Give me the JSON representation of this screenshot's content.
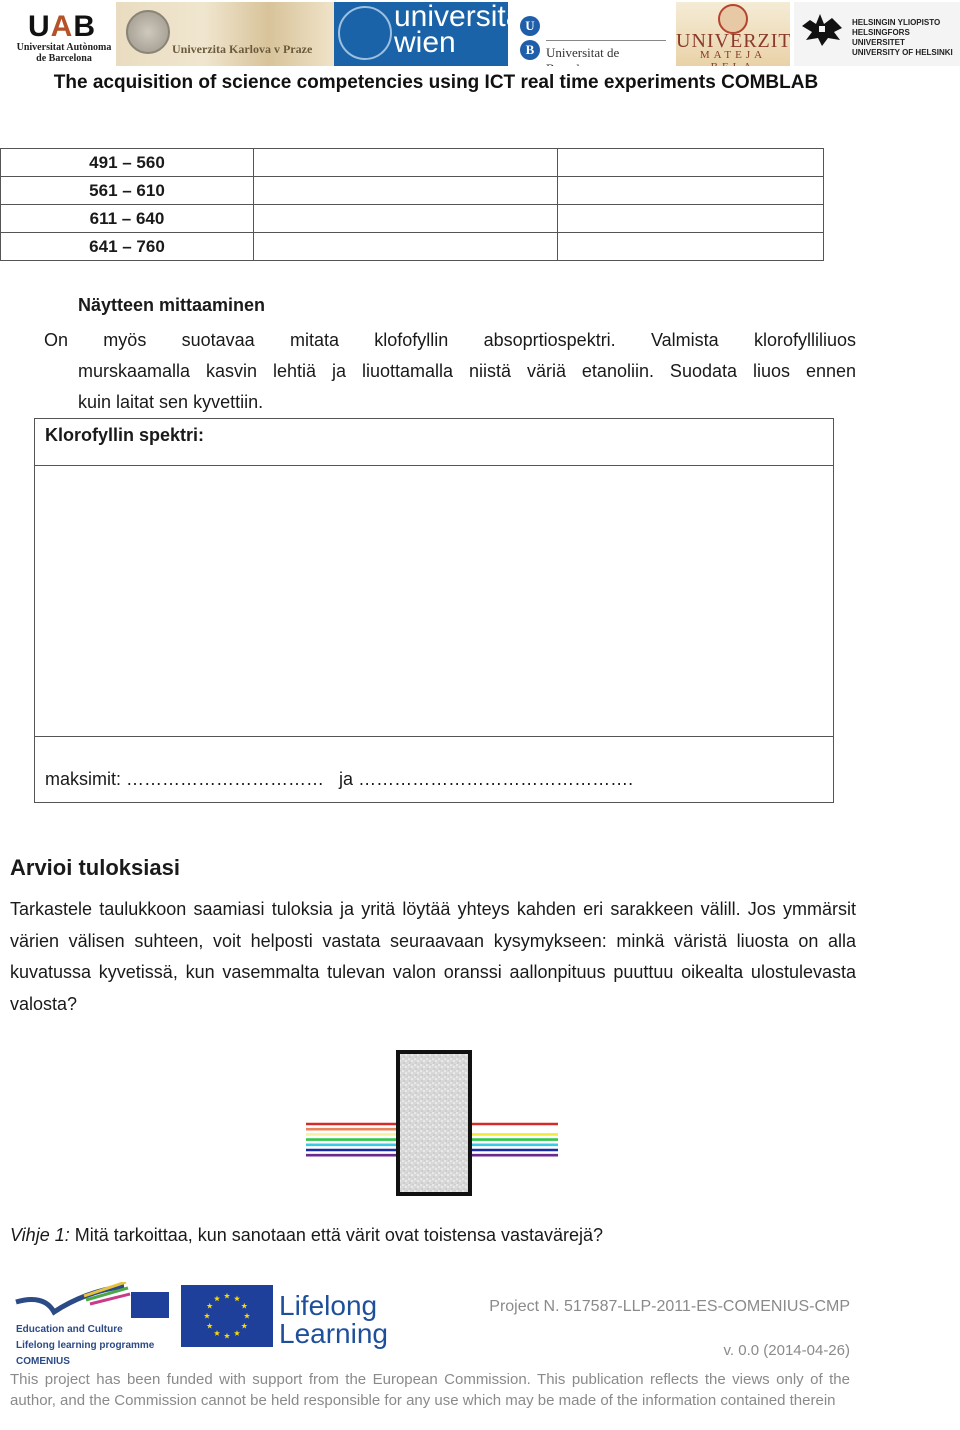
{
  "header": {
    "logos": {
      "uab": {
        "mark": "UAB",
        "line1": "Universitat Autònoma",
        "line2": "de Barcelona"
      },
      "karlova": {
        "text": "Univerzita Karlova v Praze"
      },
      "wien": {
        "line1": "universität",
        "line2": "wien"
      },
      "ub": {
        "letter1": "U",
        "letter2": "B",
        "text": "Universitat de Barcelona"
      },
      "umb": {
        "line1": "UNIVERZITA",
        "line2": "MATEJA BELA"
      },
      "helsinki": {
        "line1": "HELSINGIN YLIOPISTO",
        "line2": "HELSINGFORS UNIVERSITET",
        "line3": "UNIVERSITY OF HELSINKI"
      }
    },
    "title": "The acquisition of science competencies using ICT real time experiments COMBLAB"
  },
  "wavelength_table": {
    "rows": [
      {
        "range": "491 – 560",
        "col2": "",
        "col3": ""
      },
      {
        "range": "561 – 610",
        "col2": "",
        "col3": ""
      },
      {
        "range": "611 – 640",
        "col2": "",
        "col3": ""
      },
      {
        "range": "641 – 760",
        "col2": "",
        "col3": ""
      }
    ]
  },
  "measurement": {
    "heading": "Näytteen mittaaminen",
    "line1": "On myös suotavaa mitata klofofyllin absoprtiospektri. Valmista klorofylliliuos",
    "line2": "murskaamalla kasvin lehtiä ja liuottamalla niistä väriä etanoliin. Suodata liuos ennen",
    "line3": "kuin laitat sen kyvettiin."
  },
  "spectrum_box": {
    "label": "Klorofyllin spektri:",
    "maxima_label": "maksimit:",
    "maxima_blank1": "……………………………",
    "conjunction": "ja",
    "maxima_blank2": "……………………………………….",
    "value_1": "",
    "value_2": ""
  },
  "evaluate": {
    "heading": "Arvioi tuloksiasi",
    "text": "Tarkastele taulukkoon saamiasi tuloksia ja yritä löytää yhteys kahden eri sarakkeen välill. Jos ymmärsit värien välisen suhteen, voit helposti vastata seuraavaan kysymykseen: minkä väristä liuosta on alla kuvatussa kyvetissä, kun vasemmalta tulevan valon oranssi aallonpituus puuttuu oikealta ulostulevasta valosta?"
  },
  "cuvette_figure": {
    "incoming_colors": [
      {
        "name": "red",
        "hex": "#d42a2a"
      },
      {
        "name": "orange",
        "hex": "#e8835a"
      },
      {
        "name": "yellow",
        "hex": "#f7f0a0"
      },
      {
        "name": "green",
        "hex": "#2fc84a"
      },
      {
        "name": "cyan",
        "hex": "#3cc8e8"
      },
      {
        "name": "blue",
        "hex": "#1a2aa0"
      },
      {
        "name": "violet",
        "hex": "#6a2a90"
      }
    ],
    "outgoing_colors": [
      {
        "name": "red",
        "hex": "#d42a2a"
      },
      {
        "name": "yellow",
        "hex": "#f2ea3a"
      },
      {
        "name": "green",
        "hex": "#2fc84a"
      },
      {
        "name": "cyan",
        "hex": "#3cc8e8"
      },
      {
        "name": "blue",
        "hex": "#1a2aa0"
      },
      {
        "name": "violet",
        "hex": "#6a2a90"
      }
    ],
    "missing_color": "orange"
  },
  "hint": {
    "label": "Vihje 1:",
    "text": " Mitä tarkoittaa, kun sanotaan että värit ovat toistensa vastavärejä?"
  },
  "footer": {
    "llp": {
      "line1": "Education and Culture",
      "line2": "Lifelong learning programme",
      "line3": "COMENIUS"
    },
    "lifelong": {
      "line1": "Lifelong",
      "line2": "Learning"
    },
    "project": "Project N. 517587-LLP-2011-ES-COMENIUS-CMP",
    "version": "v. 0.0 (2014-04-26)",
    "disclaimer": "This project has been funded with support from the European Commission. This publication reflects the views only of the author, and the Commission cannot be held responsible for any use which may be made of the information contained therein"
  }
}
